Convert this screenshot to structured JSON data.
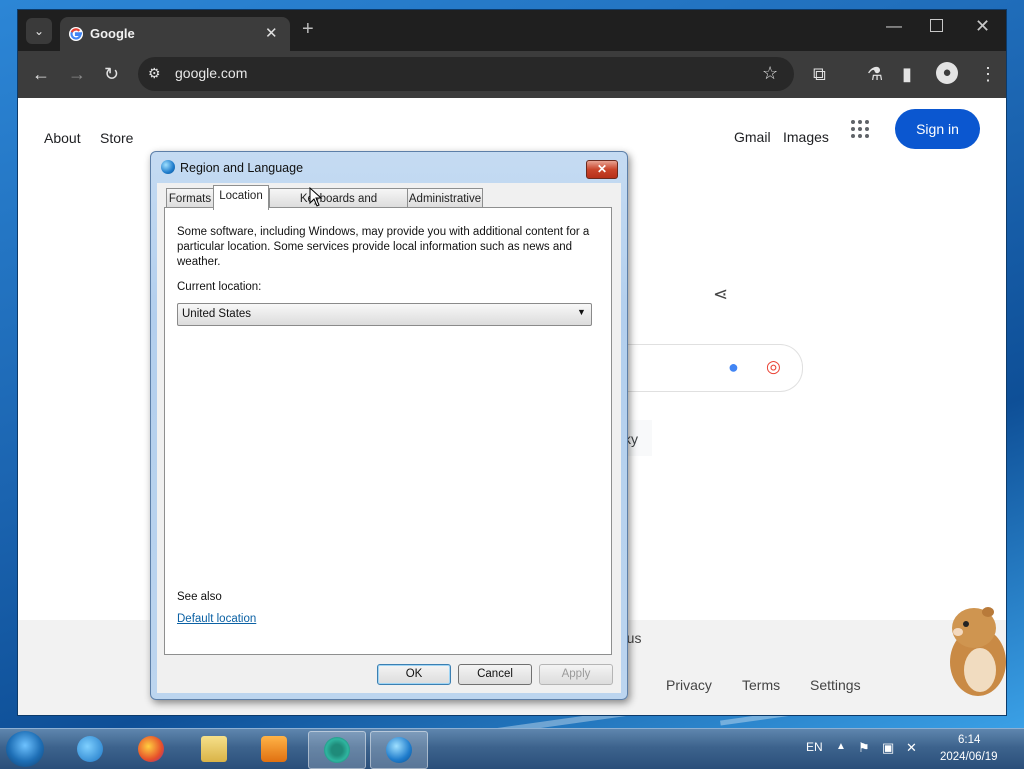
{
  "browser": {
    "tab_title": "Google",
    "url": "google.com",
    "icons": [
      "tab-list-icon",
      "google-favicon",
      "close-icon",
      "new-tab-icon",
      "minimize-icon",
      "maximize-icon",
      "window-close-icon",
      "back-icon",
      "forward-icon",
      "reload-icon",
      "site-info-icon",
      "star-icon",
      "extensions-icon",
      "labs-icon",
      "side-panel-icon",
      "profile-icon",
      "menu-icon"
    ]
  },
  "page": {
    "nav_left": [
      "About",
      "Store"
    ],
    "nav_right": [
      "Gmail",
      "Images"
    ],
    "sign_in": "Sign in",
    "partial_text": "ky",
    "footer_partial": "n us",
    "footer_links": [
      "Privacy",
      "Terms",
      "Settings"
    ]
  },
  "dialog": {
    "title": "Region and Language",
    "tabs": [
      "Formats",
      "Location",
      "Keyboards and Languages",
      "Administrative"
    ],
    "active_tab": "Location",
    "intro": "Some software, including Windows, may provide you with additional content for a particular location. Some services provide local information such as news and weather.",
    "current_location_label": "Current location:",
    "current_location_value": "United States",
    "see_also": "See also",
    "default_location_link": "Default location",
    "buttons": {
      "ok": "OK",
      "cancel": "Cancel",
      "apply": "Apply"
    }
  },
  "taskbar": {
    "language": "EN",
    "time": "6:14",
    "date": "2024/06/19"
  },
  "colors": {
    "sign_in_blue": "#0b57d0",
    "link_blue": "#0b61a4"
  }
}
